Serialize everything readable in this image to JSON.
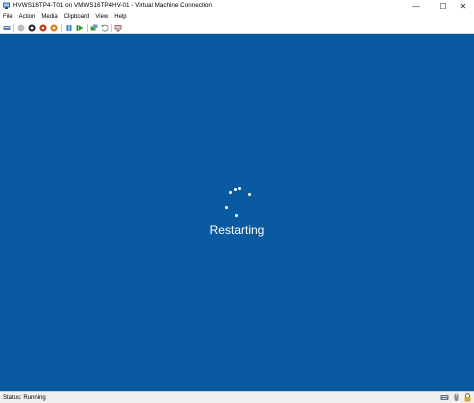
{
  "window": {
    "title": "HVWS16TP4-T01 on VMWS16TP4HV-01 - Virtual Machine Connection",
    "minimize_glyph": "—",
    "maximize_glyph": "☐",
    "close_glyph": "✕"
  },
  "menu": {
    "items": [
      "File",
      "Action",
      "Media",
      "Clipboard",
      "View",
      "Help"
    ]
  },
  "toolbar": {
    "buttons": [
      {
        "icon": "ctrl-alt-del-icon"
      },
      {
        "icon": "start-icon"
      },
      {
        "icon": "turn-off-icon"
      },
      {
        "icon": "shut-down-icon"
      },
      {
        "icon": "save-icon"
      },
      {
        "icon": "pause-icon"
      },
      {
        "icon": "reset-icon"
      },
      {
        "icon": "checkpoint-icon"
      },
      {
        "icon": "revert-icon"
      },
      {
        "icon": "enhanced-session-icon"
      }
    ]
  },
  "vm": {
    "message": "Restarting",
    "background": "#0a5aa1"
  },
  "status": {
    "text": "Status: Running",
    "icons": [
      "keyboard-icon",
      "mouse-icon",
      "lock-icon"
    ]
  }
}
